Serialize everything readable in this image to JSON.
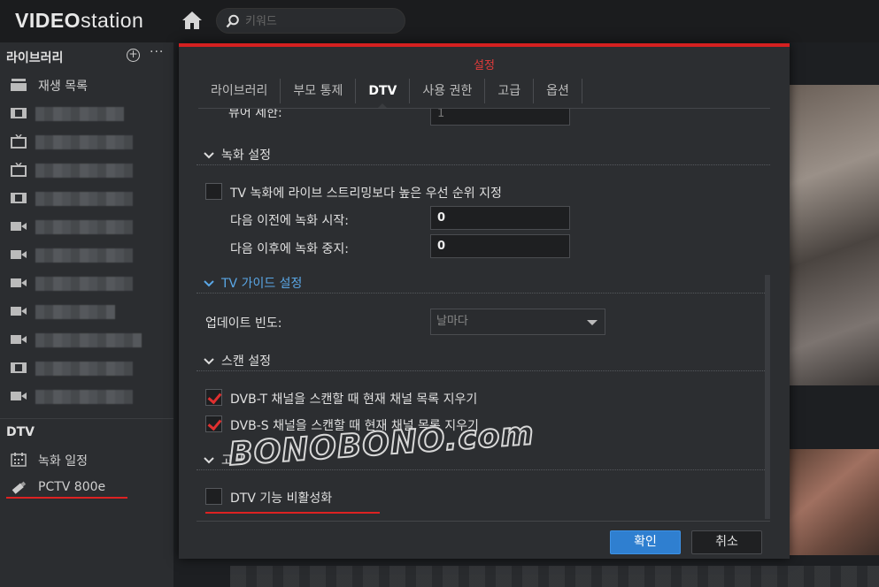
{
  "app": {
    "logo_bold": "VIDEO",
    "logo_light": "station"
  },
  "search": {
    "placeholder": "키워드"
  },
  "sidebar": {
    "library_header": "라이브러리",
    "playlist_label": "재생 목록",
    "dtv_header": "DTV",
    "dtv_items": [
      {
        "label": "녹화 일정"
      },
      {
        "label": "PCTV 800e"
      }
    ]
  },
  "dialog": {
    "title": "설정",
    "tabs": [
      "라이브러리",
      "부모 통제",
      "DTV",
      "사용 권한",
      "고급",
      "옵션"
    ],
    "active_tab": "DTV",
    "partial_label": "뷰어 제한:",
    "partial_value": "1",
    "recording_section": "녹화 설정",
    "recording_priority_label": "TV 녹화에 라이브 스트리밍보다 높은 우선 순위 지정",
    "start_before_label": "다음 이전에 녹화 시작:",
    "start_before_value": "0",
    "stop_after_label": "다음 이후에 녹화 중지:",
    "stop_after_value": "0",
    "tv_guide_section": "TV 가이드 설정",
    "update_freq_label": "업데이트 빈도:",
    "update_freq_value": "날마다",
    "scan_section": "스캔 설정",
    "dvbt_label": "DVB-T 채널을 스캔할 때 현재 채널 목록 지우기",
    "dvbs_label": "DVB-S 채널을 스캔할 때 현재 채널 목록 지우기",
    "advanced_section": "고급",
    "disable_dtv_label": "DTV 기능 비활성화",
    "ok_label": "확인",
    "cancel_label": "취소"
  },
  "checkboxes": {
    "recording_priority": false,
    "dvbt_clear": true,
    "dvbs_clear": true,
    "disable_dtv": false
  },
  "watermark": "BONOBONO.com",
  "colors": {
    "accent_red": "#d42020",
    "primary_blue": "#2f7fd0",
    "link_blue": "#5aa7e6"
  }
}
